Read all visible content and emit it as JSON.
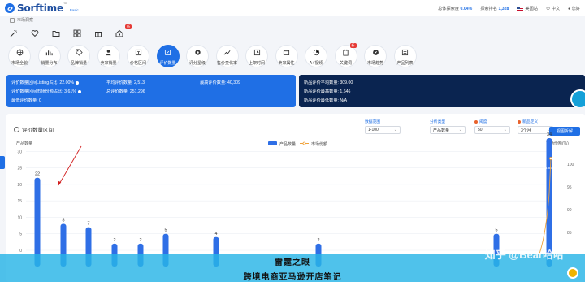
{
  "header": {
    "logo_text": "Sorftime",
    "logo_tm": "™",
    "edition": "Basic",
    "metrics": [
      {
        "label": "总体探索度",
        "value": "0.04%"
      },
      {
        "label": "探索排名",
        "value": "1,328"
      }
    ],
    "market": "美国站",
    "language": "中文",
    "user": "您好"
  },
  "breadcrumb": {
    "label": "市场洞察"
  },
  "toolbar": {
    "icons": [
      "magic-wand-icon",
      "heart-icon",
      "folder-icon",
      "grid-icon",
      "gift-icon",
      "home-lock-icon"
    ],
    "badge_text": "新"
  },
  "features": [
    {
      "label": "市场全貌",
      "icon": "globe-icon"
    },
    {
      "label": "销量分布",
      "icon": "bar-chart-icon"
    },
    {
      "label": "品牌销量",
      "icon": "tag-icon"
    },
    {
      "label": "卖家销量",
      "icon": "user-icon"
    },
    {
      "label": "价格区间",
      "icon": "price-icon"
    },
    {
      "label": "评价数量",
      "icon": "edit-icon"
    },
    {
      "label": "评分星级",
      "icon": "star-icon"
    },
    {
      "label": "售价变化率",
      "icon": "trend-icon"
    },
    {
      "label": "上架时间",
      "icon": "clock-icon"
    },
    {
      "label": "卖家属性",
      "icon": "store-icon"
    },
    {
      "label": "A+视频",
      "icon": "video-icon"
    },
    {
      "label": "关键词",
      "icon": "key-icon",
      "badge": "新"
    },
    {
      "label": "市场趋势",
      "icon": "compass-icon"
    },
    {
      "label": "产品列表",
      "icon": "list-icon"
    }
  ],
  "active_feature": "评价数量",
  "stats_blue": [
    {
      "label": "评价数量区间Listing占比:",
      "value": "22.00%",
      "info": true
    },
    {
      "label": "平均评价数量:",
      "value": "2,513"
    },
    {
      "label": "最高评价数量:",
      "value": "40,309"
    },
    {
      "label": "评价数量区间市场份额占比:",
      "value": "3.61%",
      "info": true
    },
    {
      "label": "总评价数量:",
      "value": "251,296"
    },
    {
      "label": "最低评价数量:",
      "value": "0"
    }
  ],
  "stats_dark": [
    {
      "label": "新品评价平均数量:",
      "value": "309.00"
    },
    {
      "label": "新品评价最高数量:",
      "value": "1,646"
    },
    {
      "label": "新品评价最低数量:",
      "value": "N/A"
    }
  ],
  "card": {
    "title": "评价数量区间",
    "filters": [
      {
        "label": "数据范围",
        "value": "1-100",
        "required": false
      },
      {
        "label": "分析类型",
        "value": "产品数量",
        "required": false
      },
      {
        "label": "阈度",
        "value": "50",
        "required": true
      },
      {
        "label": "新品定义",
        "value": "3个月",
        "required": true
      }
    ],
    "button": "视图拆解"
  },
  "chart_data": {
    "type": "bar",
    "title": "",
    "ylabel": "产品数量",
    "y2label": "市场份额(%)",
    "ylim": [
      0,
      35
    ],
    "yticks": [
      0,
      5,
      10,
      15,
      20,
      25,
      30
    ],
    "y2ticks": [
      85,
      90,
      95,
      100
    ],
    "legend": [
      "产品数量",
      "市场份额"
    ],
    "legend_position": "top-center",
    "bars": [
      {
        "value": 22
      },
      {
        "value": 8
      },
      {
        "value": 7
      },
      {
        "value": 2
      },
      {
        "value": 2
      },
      {
        "value": 5
      },
      {
        "value": 4
      },
      {
        "value": 2
      },
      {
        "value": 5
      },
      {
        "value": 34
      }
    ],
    "last_bar_label": "88.65%",
    "colors": {
      "bar": "#2f6fe6",
      "line": "#f0a23a"
    }
  },
  "overlay": {
    "line1": "雷霆之眼",
    "line2": "跨境电商亚马逊开店笔记",
    "watermark": "知乎 @Bear哈哈"
  },
  "colors": {
    "primary": "#1f6fe5",
    "dark": "#0a2450",
    "overlay": "#28b4e6"
  }
}
